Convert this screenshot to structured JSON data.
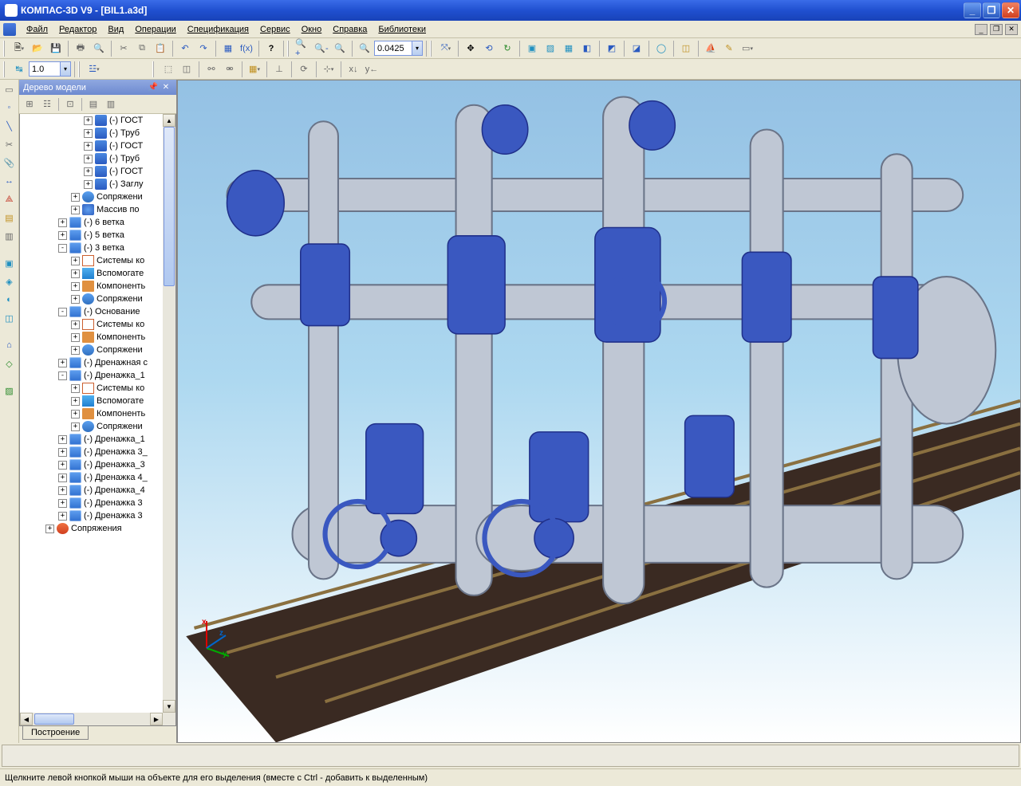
{
  "title": "КОМПАС-3D V9 - [BIL1.a3d]",
  "menu": [
    "Файл",
    "Редактор",
    "Вид",
    "Операции",
    "Спецификация",
    "Сервис",
    "Окно",
    "Справка",
    "Библиотеки"
  ],
  "toolbar2": {
    "scale": "1.0"
  },
  "zoom_value": "0.0425",
  "tree": {
    "title": "Дерево модели",
    "tab": "Построение",
    "nodes": [
      {
        "d": 5,
        "e": "+",
        "i": "part",
        "t": "(-) ГОСТ"
      },
      {
        "d": 5,
        "e": "+",
        "i": "part",
        "t": "(-) Труб"
      },
      {
        "d": 5,
        "e": "+",
        "i": "part",
        "t": "(-) ГОСТ"
      },
      {
        "d": 5,
        "e": "+",
        "i": "part",
        "t": "(-) Труб"
      },
      {
        "d": 5,
        "e": "+",
        "i": "part",
        "t": "(-) ГОСТ"
      },
      {
        "d": 5,
        "e": "+",
        "i": "part",
        "t": "(-) Заглу"
      },
      {
        "d": 4,
        "e": "+",
        "i": "sop",
        "t": "Сопряжени"
      },
      {
        "d": 4,
        "e": "+",
        "i": "mass",
        "t": "Массив по"
      },
      {
        "d": 3,
        "e": "+",
        "i": "asm",
        "t": "(-) 6 ветка"
      },
      {
        "d": 3,
        "e": "+",
        "i": "asm",
        "t": "(-) 5 ветка"
      },
      {
        "d": 3,
        "e": "-",
        "i": "asm",
        "t": "(-) 3 ветка"
      },
      {
        "d": 4,
        "e": "+",
        "i": "sys",
        "t": "Системы ко"
      },
      {
        "d": 4,
        "e": "+",
        "i": "aux",
        "t": "Вспомогате"
      },
      {
        "d": 4,
        "e": "+",
        "i": "comp",
        "t": "Компоненть"
      },
      {
        "d": 4,
        "e": "+",
        "i": "sop",
        "t": "Сопряжени"
      },
      {
        "d": 3,
        "e": "-",
        "i": "asm",
        "t": "(-) Основание"
      },
      {
        "d": 4,
        "e": "+",
        "i": "sys",
        "t": "Системы ко"
      },
      {
        "d": 4,
        "e": "+",
        "i": "comp",
        "t": "Компоненть"
      },
      {
        "d": 4,
        "e": "+",
        "i": "sop",
        "t": "Сопряжени"
      },
      {
        "d": 3,
        "e": "+",
        "i": "asm",
        "t": "(-) Дренажная с"
      },
      {
        "d": 3,
        "e": "-",
        "i": "asm",
        "t": "(-) Дренажка_1"
      },
      {
        "d": 4,
        "e": "+",
        "i": "sys",
        "t": "Системы ко"
      },
      {
        "d": 4,
        "e": "+",
        "i": "aux",
        "t": "Вспомогате"
      },
      {
        "d": 4,
        "e": "+",
        "i": "comp",
        "t": "Компоненть"
      },
      {
        "d": 4,
        "e": "+",
        "i": "sop",
        "t": "Сопряжени"
      },
      {
        "d": 3,
        "e": "+",
        "i": "asm",
        "t": "(-) Дренажка_1"
      },
      {
        "d": 3,
        "e": "+",
        "i": "asm",
        "t": "(-) Дренажка 3_"
      },
      {
        "d": 3,
        "e": "+",
        "i": "asm",
        "t": "(-) Дренажка_3"
      },
      {
        "d": 3,
        "e": "+",
        "i": "asm",
        "t": "(-) Дренажка 4_"
      },
      {
        "d": 3,
        "e": "+",
        "i": "asm",
        "t": "(-) Дренажка_4"
      },
      {
        "d": 3,
        "e": "+",
        "i": "asm",
        "t": "(-) Дренажка 3"
      },
      {
        "d": 3,
        "e": "+",
        "i": "asm",
        "t": "(-) Дренажка 3"
      },
      {
        "d": 2,
        "e": "+",
        "i": "red",
        "t": "Сопряжения"
      }
    ]
  },
  "status": "Щелкните левой кнопкой мыши на объекте для его выделения (вместе с Ctrl - добавить к выделенным)",
  "axis": {
    "x": "x",
    "y": "y",
    "z": "z"
  }
}
